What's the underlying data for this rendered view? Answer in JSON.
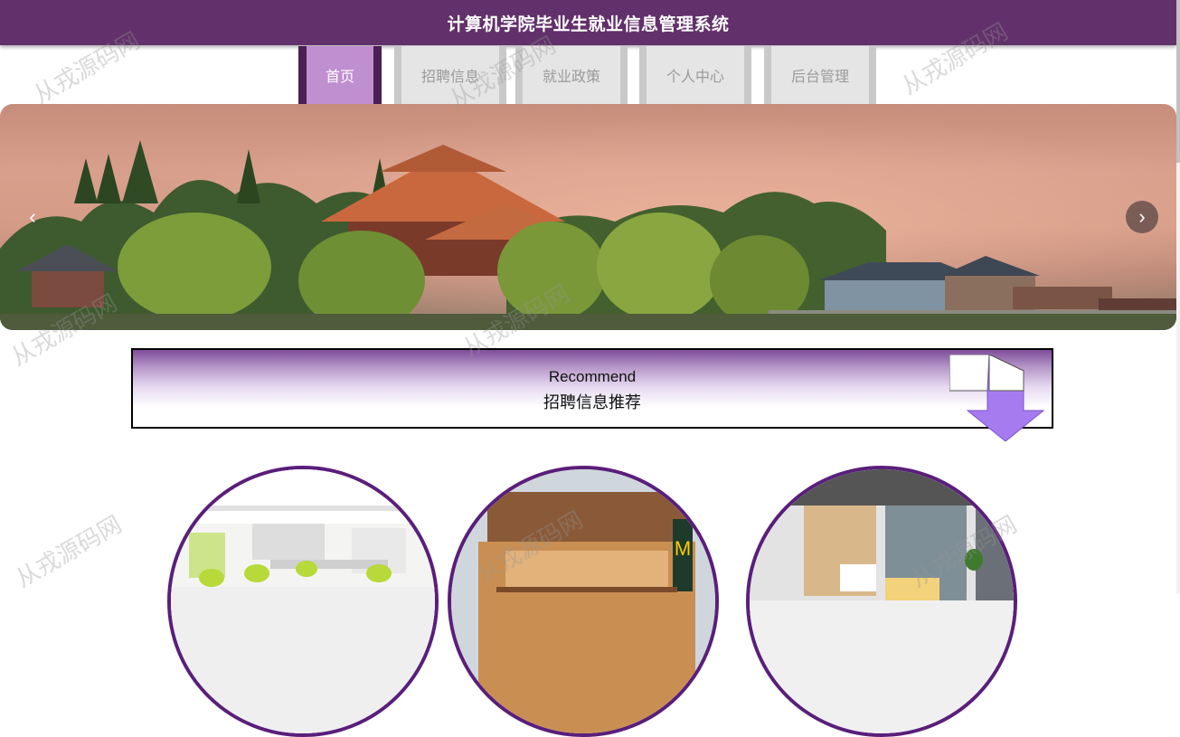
{
  "header": {
    "title": "计算机学院毕业生就业信息管理系统"
  },
  "nav": {
    "items": [
      {
        "label": "首页",
        "active": true
      },
      {
        "label": "招聘信息",
        "active": false
      },
      {
        "label": "就业政策",
        "active": false
      },
      {
        "label": "个人中心",
        "active": false
      },
      {
        "label": "后台管理",
        "active": false
      }
    ]
  },
  "banner": {
    "prev_icon": "chevron-left-icon",
    "next_icon": "chevron-right-icon",
    "prev_glyph": "‹",
    "next_glyph": "›"
  },
  "recommend": {
    "title_en": "Recommend",
    "title_cn": "招聘信息推荐",
    "icon": "arrow-down-icon"
  },
  "cards": [
    {
      "image": "office-interior"
    },
    {
      "image": "mcdonalds-storefront"
    },
    {
      "image": "modern-office-lobby"
    }
  ],
  "watermark": {
    "text": "从戎源码网"
  },
  "colors": {
    "header_bg": "#62306b",
    "nav_active_bg": "#c08fcf",
    "accent_purple": "#5a1e7b",
    "arrow_fill": "#a77bf0"
  }
}
